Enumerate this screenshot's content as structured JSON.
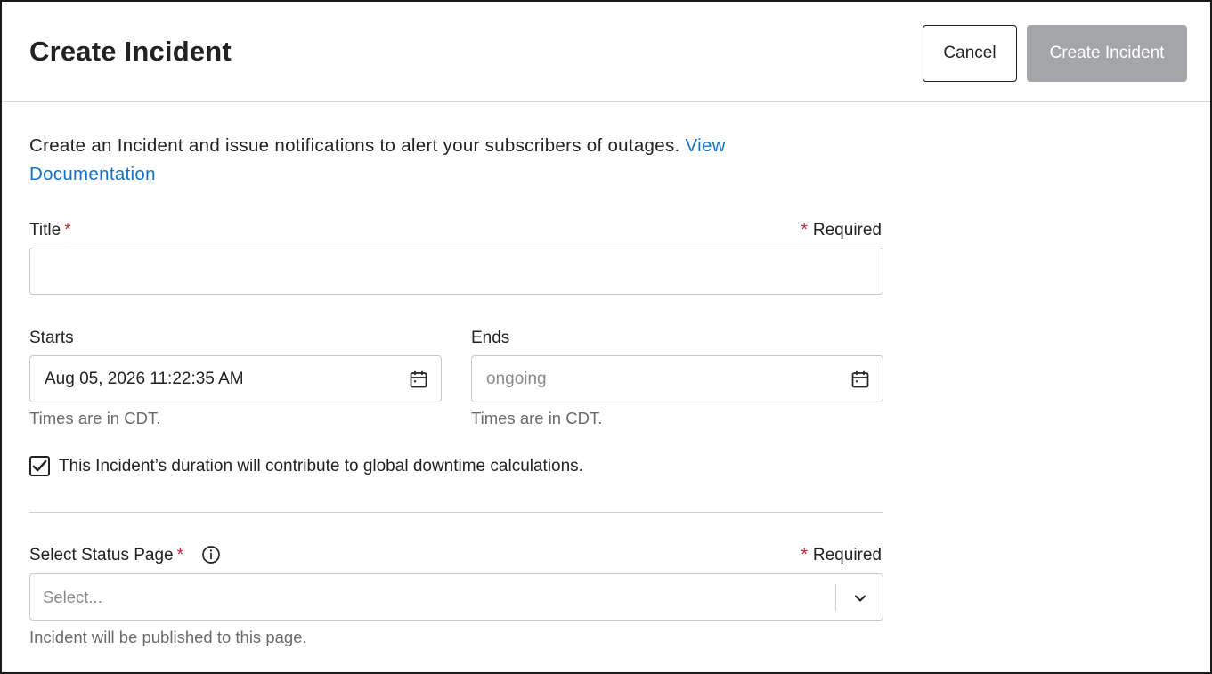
{
  "header": {
    "title": "Create Incident",
    "cancel_label": "Cancel",
    "create_label": "Create Incident"
  },
  "intro": {
    "text": "Create an Incident and issue notifications to alert your subscribers of outages. ",
    "link_text": "View Documentation"
  },
  "form": {
    "title_field": {
      "label": "Title",
      "star": "*",
      "required_note": "Required",
      "value": ""
    },
    "starts": {
      "label": "Starts",
      "value": "Aug 05, 2026 11:22:35 AM",
      "hint": "Times are in CDT.",
      "icon": "calendar-icon"
    },
    "ends": {
      "label": "Ends",
      "placeholder": "ongoing",
      "hint": "Times are in CDT.",
      "icon": "calendar-icon"
    },
    "downtime_checkbox": {
      "checked": true,
      "label": "This Incident’s duration will contribute to global downtime calculations."
    },
    "status_page": {
      "label": "Select Status Page",
      "star": "*",
      "required_note": "Required",
      "placeholder": "Select...",
      "hint": "Incident will be published to this page.",
      "icon": "info-icon"
    }
  },
  "colors": {
    "link": "#1670c4",
    "required_star": "#c4262e",
    "disabled_button": "#a3a5a8"
  }
}
